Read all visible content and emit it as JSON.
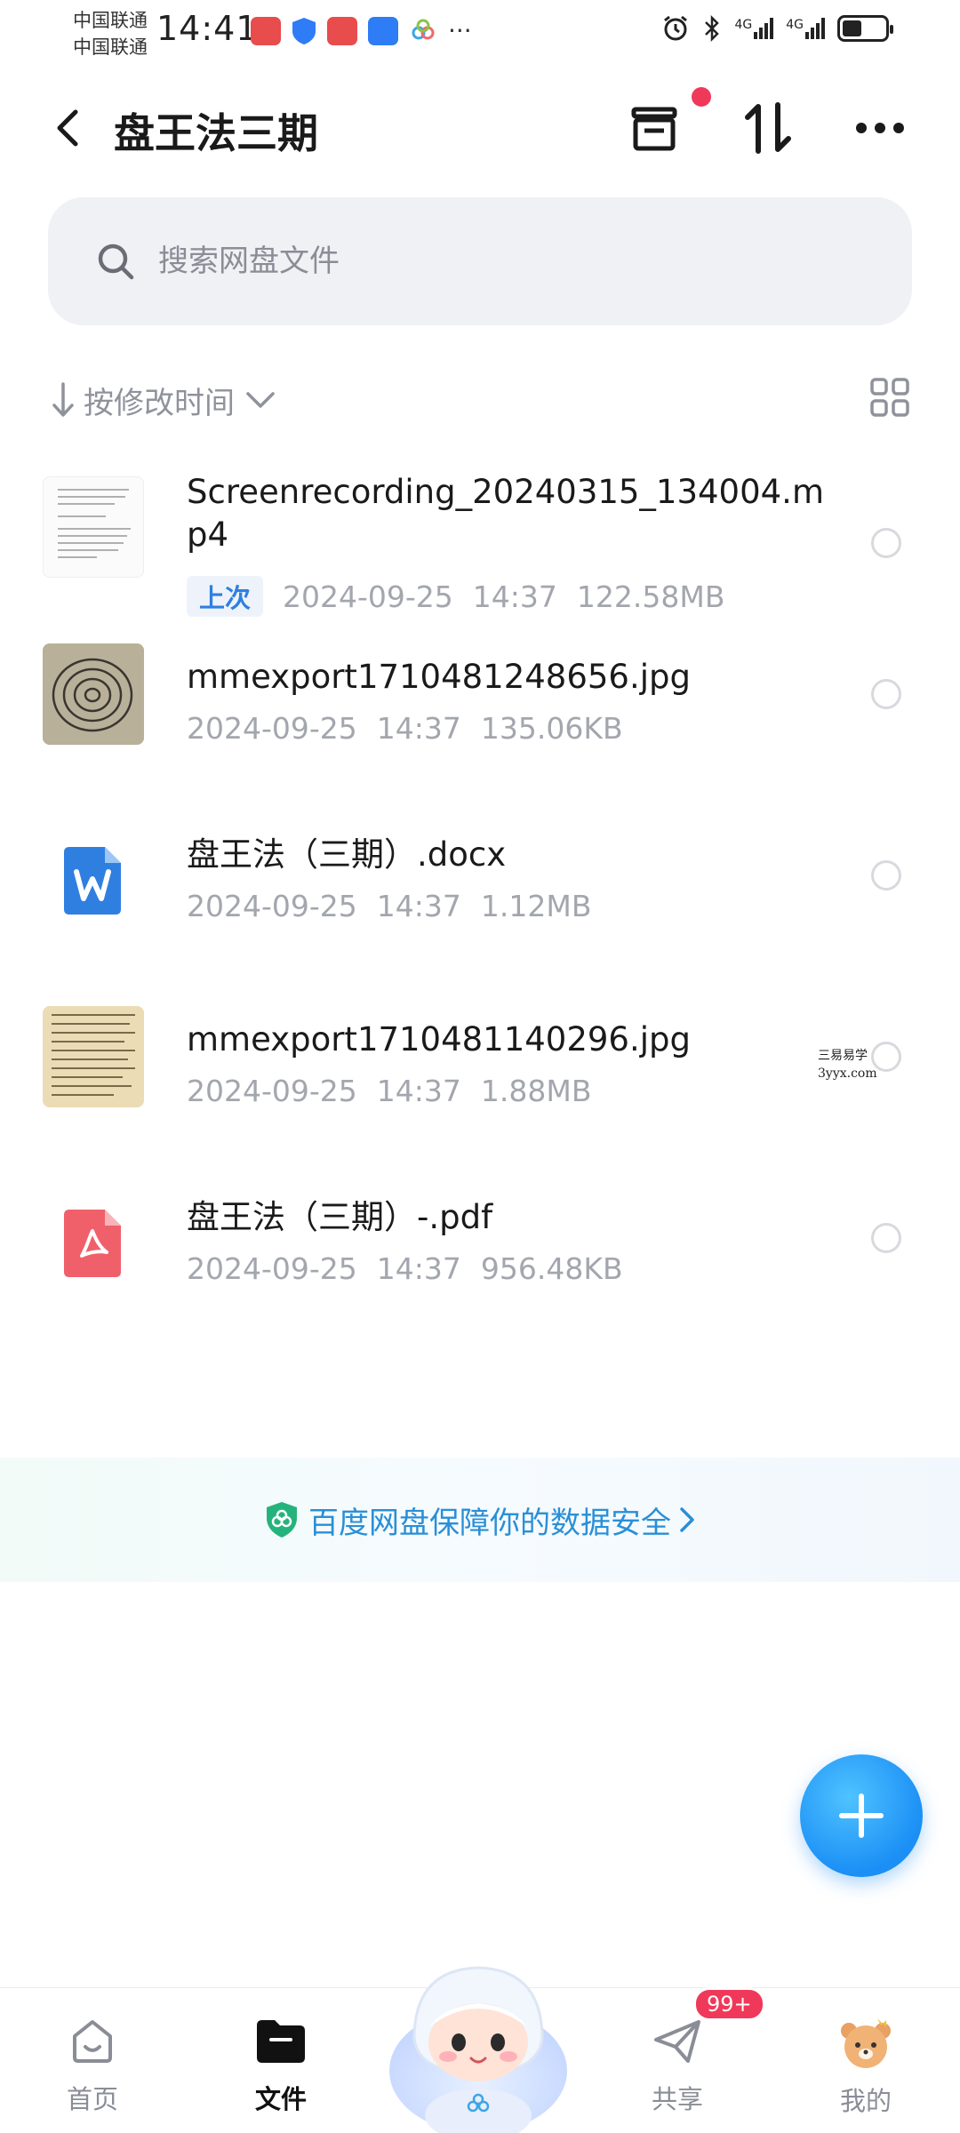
{
  "status": {
    "carrier_1": "中国联通",
    "carrier_2": "中国联通",
    "time": "14:41",
    "net_1": "4G",
    "net_2": "4G",
    "battery_level": 0.45
  },
  "header": {
    "title": "盘王法三期"
  },
  "search": {
    "placeholder": "搜索网盘文件"
  },
  "sort": {
    "label": "按修改时间"
  },
  "files": [
    {
      "name": "Screenrecording_20240315_134004.mp4",
      "badge": "上次",
      "date": "2024-09-25",
      "time": "14:37",
      "size": "122.58MB",
      "type": "video"
    },
    {
      "name": "mmexport1710481248656.jpg",
      "date": "2024-09-25",
      "time": "14:37",
      "size": "135.06KB",
      "type": "image"
    },
    {
      "name": "盘王法（三期）.docx",
      "date": "2024-09-25",
      "time": "14:37",
      "size": "1.12MB",
      "type": "docx"
    },
    {
      "name": "mmexport1710481140296.jpg",
      "date": "2024-09-25",
      "time": "14:37",
      "size": "1.88MB",
      "type": "image"
    },
    {
      "name": "盘王法（三期）-.pdf",
      "date": "2024-09-25",
      "time": "14:37",
      "size": "956.48KB",
      "type": "pdf"
    }
  ],
  "watermark": {
    "line1": "三易易学",
    "line2": "3yyx.com"
  },
  "banner": {
    "text": "百度网盘保障你的数据安全"
  },
  "nav": {
    "home": "首页",
    "files": "文件",
    "share": "共享",
    "mine": "我的",
    "share_badge": "99+"
  },
  "colors": {
    "accent": "#2a8fd6",
    "fab": "#1b8ff5",
    "badge_red": "#f0385a",
    "docx_blue": "#2f7fe0",
    "pdf_red": "#f0606a"
  }
}
